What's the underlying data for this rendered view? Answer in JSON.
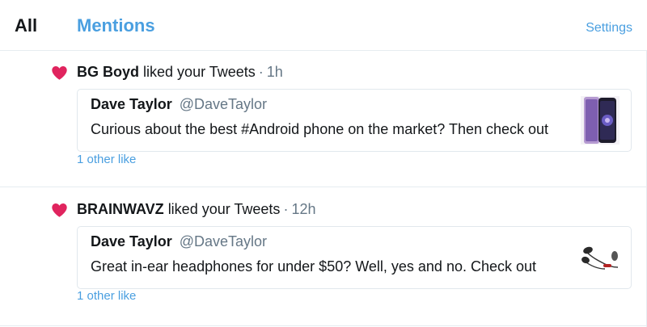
{
  "tabs": {
    "all_label": "All",
    "mentions_label": "Mentions",
    "settings_label": "Settings"
  },
  "colors": {
    "accent": "#4a9fe0",
    "heart": "#e0245e",
    "secondary_text": "#657786"
  },
  "notifications": [
    {
      "actor": "BG Boyd",
      "action": "liked your Tweets",
      "separator": "·",
      "time": "1h",
      "tweet": {
        "name": "Dave Taylor",
        "handle": "@DaveTaylor",
        "text": "Curious about the best #Android phone on the market? Then check out"
      },
      "thumbnail": "phone-image",
      "other_likes": "1 other like"
    },
    {
      "actor": "BRAINWAVZ",
      "action": "liked your Tweets",
      "separator": "·",
      "time": "12h",
      "tweet": {
        "name": "Dave Taylor",
        "handle": "@DaveTaylor",
        "text": "Great in-ear headphones for under $50? Well, yes and no. Check out"
      },
      "thumbnail": "headphones-image",
      "other_likes": "1 other like"
    }
  ]
}
